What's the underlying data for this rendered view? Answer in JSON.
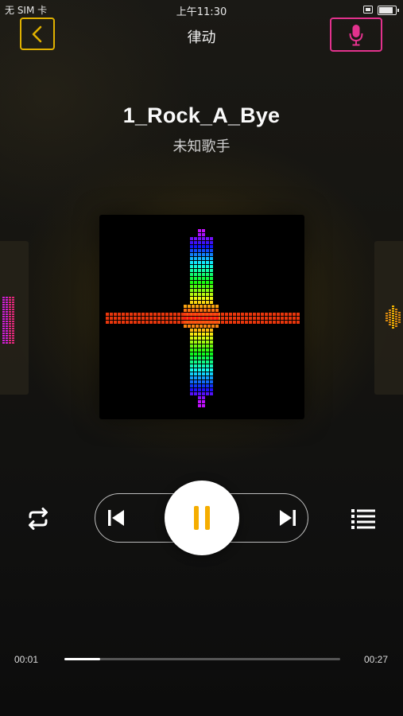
{
  "status_bar": {
    "carrier": "无 SIM 卡",
    "time": "上午11:30",
    "battery_level": 0.9
  },
  "nav": {
    "title": "律动",
    "back_icon": "chevron-left-icon",
    "mic_icon": "microphone-icon"
  },
  "song": {
    "title": "1_Rock_A_Bye",
    "artist": "未知歌手"
  },
  "player": {
    "state": "playing",
    "repeat_icon": "repeat-icon",
    "prev_icon": "skip-previous-icon",
    "pause_icon": "pause-icon",
    "next_icon": "skip-next-icon",
    "playlist_icon": "playlist-icon"
  },
  "progress": {
    "current": "00:01",
    "total": "00:27",
    "fraction": 0.13
  },
  "colors": {
    "back_border": "#e0b100",
    "mic_accent": "#e2328d",
    "pause_color": "#f5ad00",
    "visualizer_center": "#e8360c"
  }
}
